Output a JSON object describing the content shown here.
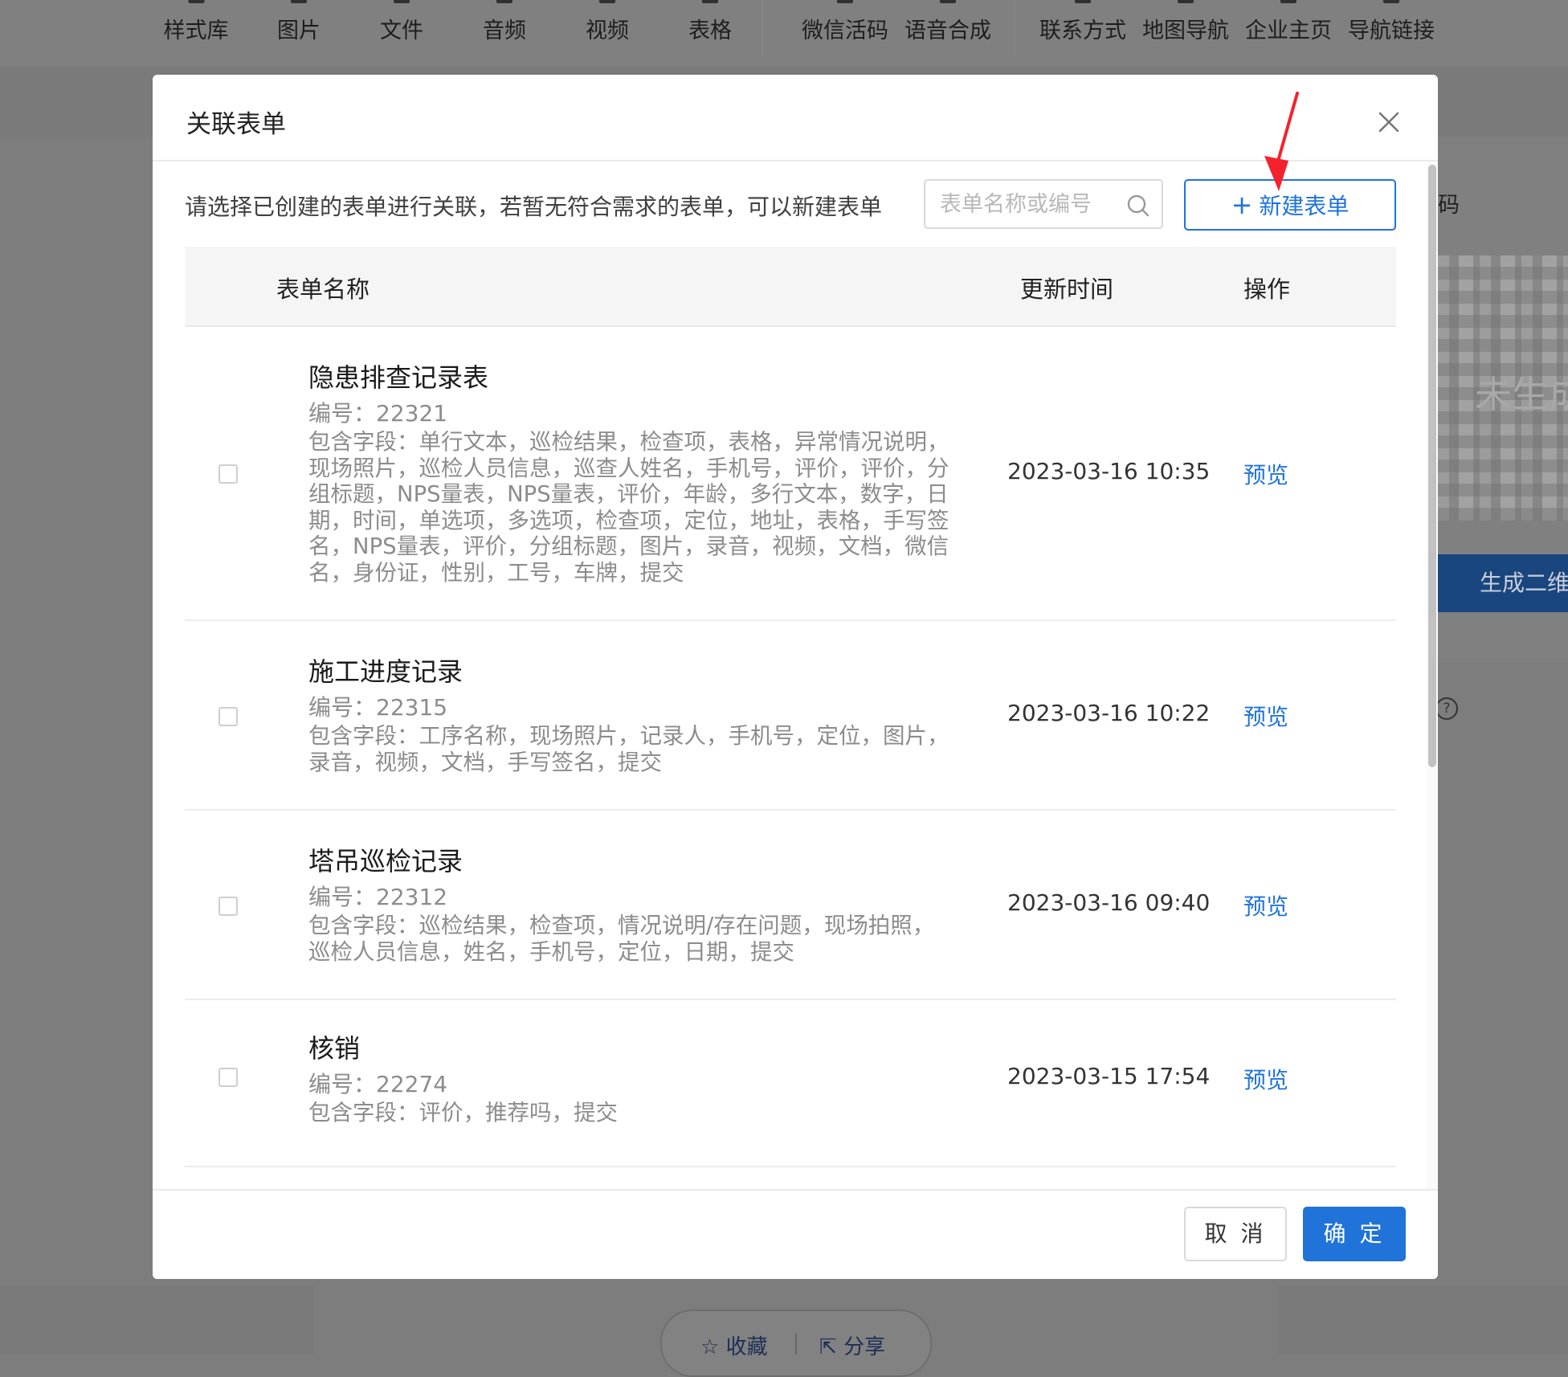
{
  "background": {
    "toolbar_items": [
      "样式库",
      "图片",
      "文件",
      "音频",
      "视频",
      "表格",
      "微信活码",
      "语音合成",
      "联系方式",
      "地图导航",
      "企业主页",
      "导航链接"
    ],
    "side_panel_label": "码",
    "qr_status": "未生成",
    "generate_button": "生成二维码",
    "bottom_actions": {
      "favorite": "收藏",
      "share": "分享"
    }
  },
  "modal": {
    "title": "关联表单",
    "description": "请选择已创建的表单进行关联，若暂无符合需求的表单，可以新建表单",
    "search": {
      "placeholder": "表单名称或编号",
      "value": ""
    },
    "new_button": "新建表单",
    "columns": {
      "name": "表单名称",
      "updated": "更新时间",
      "action": "操作"
    },
    "rows": [
      {
        "name": "隐患排查记录表",
        "code": "编号：22321",
        "fields": "包含字段：单行文本，巡检结果，检查项，表格，异常情况说明，现场照片，巡检人员信息，巡查人姓名，手机号，评价，评价，分组标题，NPS量表，NPS量表，评价，年龄，多行文本，数字，日期，时间，单选项，多选项，检查项，定位，地址，表格，手写签名，NPS量表，评价，分组标题，图片，录音，视频，文档，微信名，身份证，性别，工号，车牌，提交",
        "updated": "2023-03-16 10:35",
        "action": "预览"
      },
      {
        "name": "施工进度记录",
        "code": "编号：22315",
        "fields": "包含字段：工序名称，现场照片，记录人，手机号，定位，图片，录音，视频，文档，手写签名，提交",
        "updated": "2023-03-16 10:22",
        "action": "预览"
      },
      {
        "name": "塔吊巡检记录",
        "code": "编号：22312",
        "fields": "包含字段：巡检结果，检查项，情况说明/存在问题，现场拍照，巡检人员信息，姓名，手机号，定位，日期，提交",
        "updated": "2023-03-16 09:40",
        "action": "预览"
      },
      {
        "name": "核销",
        "code": "编号：22274",
        "fields": "包含字段：评价，推荐吗，提交",
        "updated": "2023-03-15 17:54",
        "action": "预览"
      }
    ],
    "footer": {
      "cancel": "取 消",
      "confirm": "确 定"
    }
  },
  "colors": {
    "primary": "#1f73d9",
    "annotation_arrow": "#f5222d",
    "overlay": "#7d7d7d"
  },
  "icons": {
    "close": "close-icon",
    "search": "search-icon",
    "plus": "plus-icon",
    "arrow": "red-arrow-annotation"
  }
}
